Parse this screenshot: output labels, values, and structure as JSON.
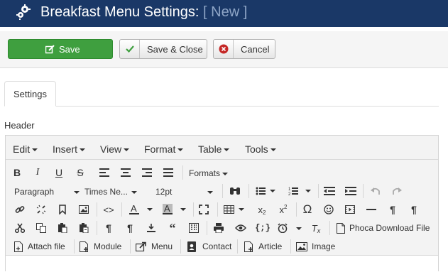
{
  "header": {
    "title": "Breakfast Menu Settings:",
    "suffix": "[ New ]"
  },
  "toolbar": {
    "save": "Save",
    "save_close": "Save & Close",
    "cancel": "Cancel"
  },
  "tabs": [
    {
      "label": "Settings"
    }
  ],
  "field": {
    "label": "Header"
  },
  "editor": {
    "menus": [
      "Edit",
      "Insert",
      "View",
      "Format",
      "Table",
      "Tools"
    ],
    "formats_label": "Formats",
    "block_format": "Paragraph",
    "font_family": "Times Ne...",
    "font_size": "12pt",
    "buttons": {
      "phoca": "Phoca Download File",
      "attach": "Attach file",
      "module": "Module",
      "menu": "Menu",
      "contact": "Contact",
      "article": "Article",
      "image": "Image"
    }
  }
}
